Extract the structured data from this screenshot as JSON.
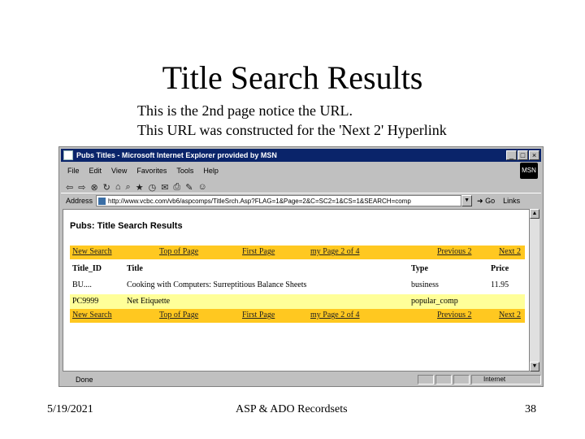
{
  "slide": {
    "title": "Title Search Results",
    "subtitle_line1": "This is the 2nd page notice the URL.",
    "subtitle_line2": "This URL was constructed for the 'Next 2' Hyperlink",
    "footer_date": "5/19/2021",
    "footer_center": "ASP & ADO Recordsets",
    "footer_page": "38"
  },
  "browser": {
    "window_title": "Pubs Titles - Microsoft Internet Explorer provided by MSN",
    "menu": [
      "File",
      "Edit",
      "View",
      "Favorites",
      "Tools",
      "Help"
    ],
    "address_label": "Address",
    "address_value": "http://www.vcbc.com/vb6/aspcomps/TitleSrch.Asp?FLAG=1&Page=2&C=SC2=1&CS=1&SEARCH=comp",
    "go_label": "Go",
    "links_label": "Links",
    "status_text": "Done",
    "zone_text": "Internet",
    "msn_label": "MSN"
  },
  "page": {
    "heading": "Pubs: Title Search Results",
    "nav": {
      "new_search": "New Search",
      "top_of_page": "Top of Page",
      "first_page": "First Page",
      "page_info": "my Page 2 of 4",
      "previous": "Previous 2",
      "next": "Next 2"
    },
    "table": {
      "columns": [
        "Title_ID",
        "Title",
        "Type",
        "Price"
      ],
      "rows": [
        {
          "id": "BU....",
          "title": "Cooking with Computers: Surreptitious Balance Sheets",
          "type": "business",
          "price": "11.95"
        },
        {
          "id": "PC9999",
          "title": "Net Etiquette",
          "type": "popular_comp",
          "price": ""
        }
      ]
    }
  },
  "colors": {
    "nav_bar": "#ffc820",
    "alt_row": "#ffff99",
    "titlebar": "#0a246a"
  }
}
